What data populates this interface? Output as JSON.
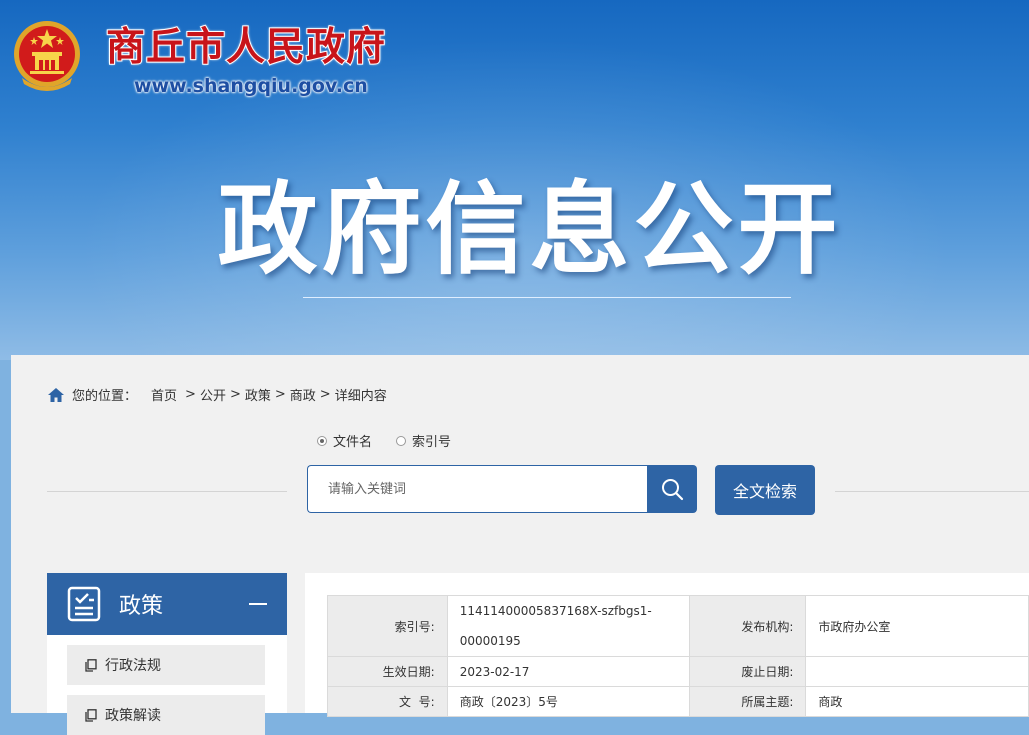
{
  "header": {
    "site_name": "商丘市人民政府",
    "site_url": "www.shangqiu.gov.cn",
    "banner_title": "政府信息公开"
  },
  "breadcrumb": {
    "label": "您的位置：",
    "items": [
      "首页",
      "公开",
      "政策",
      "商政",
      "详细内容"
    ],
    "separator": ">"
  },
  "search": {
    "options": [
      "文件名",
      "索引号"
    ],
    "selected": "文件名",
    "placeholder": "请输入关键词",
    "fulltext_label": "全文检索"
  },
  "sidebar": {
    "title": "政策",
    "items": [
      "行政法规",
      "政策解读"
    ]
  },
  "info_table": {
    "rows": [
      {
        "k1": "索引号:",
        "v1a": "11411400005837168X-szfbgs1-",
        "v1b": "00000195",
        "k2": "发布机构:",
        "v2": "市政府办公室"
      },
      {
        "k1": "生效日期:",
        "v1": "2023-02-17",
        "k2": "废止日期:",
        "v2": ""
      },
      {
        "k1": "文  号:",
        "v1": "商政〔2023〕5号",
        "k2": "所属主题:",
        "v2": "商政"
      }
    ]
  },
  "colors": {
    "primary": "#2e64a5",
    "site_name": "#c8141a",
    "url": "#1d4ea3"
  }
}
